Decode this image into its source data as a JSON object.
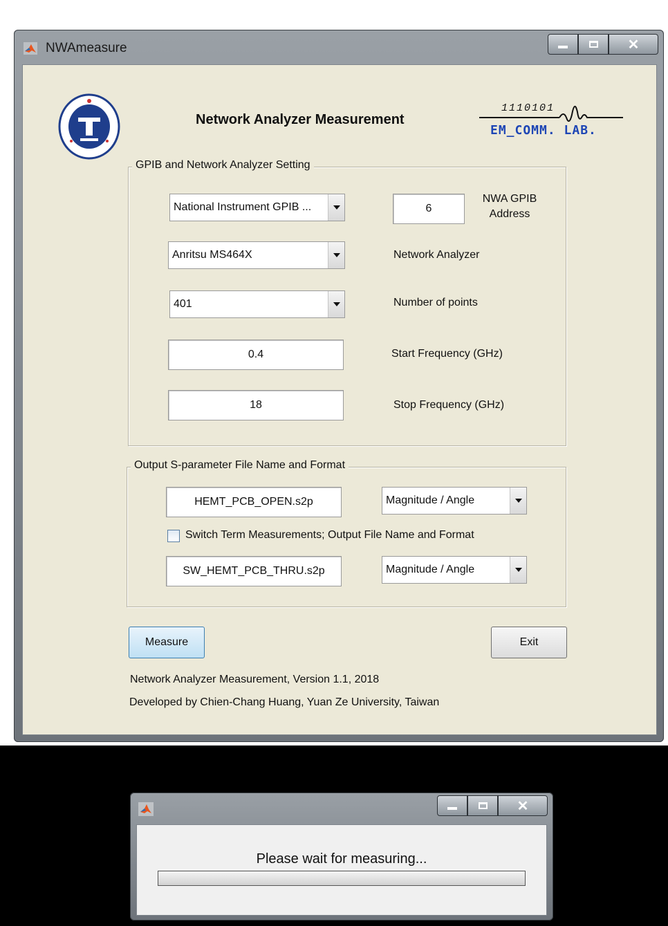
{
  "window": {
    "title": "NWAmeasure",
    "heading": "Network Analyzer Measurement",
    "caption_buttons": {
      "minimize": "▁",
      "maximize": "□",
      "close": "X"
    }
  },
  "logos": {
    "university": "YUAN ZE UNIVERSITY",
    "lab_binary": "1110101",
    "lab_name": "EM_COMM. LAB."
  },
  "gpib_group": {
    "label": "GPIB and Network Analyzer Setting",
    "interface_select": "National Instrument GPIB ...",
    "nwa_address_value": "6",
    "nwa_address_label_line1": "NWA GPIB",
    "nwa_address_label_line2": "Address",
    "analyzer_select": "Anritsu MS464X",
    "analyzer_label": "Network Analyzer",
    "points_select": "401",
    "points_label": "Number of points",
    "start_freq_value": "0.4",
    "start_freq_label": "Start Frequency (GHz)",
    "stop_freq_value": "18",
    "stop_freq_label": "Stop Frequency (GHz)"
  },
  "output_group": {
    "label": "Output S-parameter File Name and Format",
    "file_name": "HEMT_PCB_OPEN.s2p",
    "format_select": "Magnitude / Angle",
    "switch_term_checked": false,
    "switch_term_label": "Switch Term Measurements; Output File Name and Format",
    "sw_file_name": "SW_HEMT_PCB_THRU.s2p",
    "sw_format_select": "Magnitude / Angle"
  },
  "buttons": {
    "measure": "Measure",
    "exit": "Exit"
  },
  "footer": {
    "version": "Network Analyzer Measurement, Version 1.1, 2018",
    "developer": "Developed by Chien-Chang Huang, Yuan Ze University, Taiwan"
  },
  "progress_dialog": {
    "message": "Please wait for measuring...",
    "progress_fraction": 0.0,
    "caption_buttons": {
      "minimize": "▁",
      "maximize": "□",
      "close": "X"
    }
  },
  "colors": {
    "client_bg": "#ece9d8",
    "frame": "#8f969d",
    "focus_button": "#bfe0f4",
    "matlab_icon": "#e8561f"
  }
}
